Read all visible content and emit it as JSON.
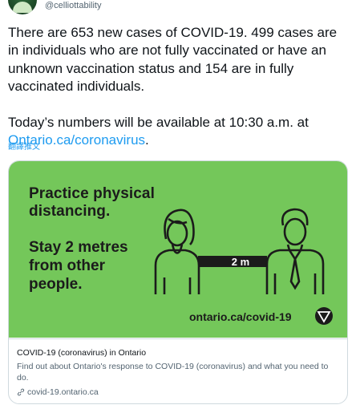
{
  "header": {
    "handle": "@celliottability"
  },
  "tweet": {
    "line1": "There are 653 new cases of COVID-19. 499 cases are in individuals who are not fully vaccinated or have an unknown vaccination status and 154 are in fully vaccinated individuals.",
    "line2_prefix": "Today’s numbers will be available at 10:30 a.m. at",
    "line2_link": "Ontario.ca/coronavirus",
    "line2_suffix": ".",
    "translate_label": "翻譯推文"
  },
  "card": {
    "image": {
      "headline_1": "Practice physical",
      "headline_2": "distancing.",
      "sub_1": "Stay 2 metres",
      "sub_2": "from other",
      "sub_3": "people.",
      "distance_label": "2 m",
      "url": "ontario.ca/covid-19",
      "bg_color": "#74c75a"
    },
    "title": "COVID-19 (coronavirus) in Ontario",
    "description": "Find out about Ontario's response to COVID-19 (coronavirus) and what you need to do.",
    "domain": "covid-19.ontario.ca"
  },
  "colors": {
    "link": "#1d9bf0",
    "secondary_text": "#536471",
    "border": "#cfd9de"
  }
}
